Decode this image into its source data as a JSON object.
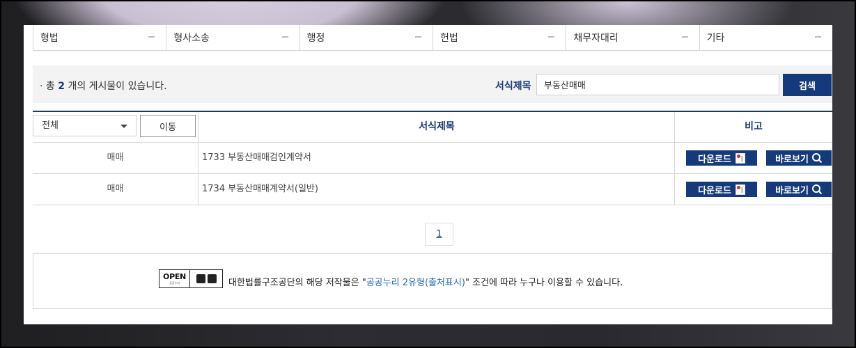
{
  "categories": [
    "형법",
    "형사소송",
    "행정",
    "헌법",
    "채무자대리",
    "기타"
  ],
  "search": {
    "total_prefix": "· 총",
    "total_count": "2",
    "total_suffix": "개의 게시물이 있습니다.",
    "label": "서식제목",
    "value": "부동산매매",
    "button": "검색"
  },
  "table": {
    "filter_value": "전체",
    "move_button": "이동",
    "col_title": "서식제목",
    "col_note": "비고",
    "rows": [
      {
        "category": "매매",
        "title": "1733 부동산매매검인계약서",
        "download": "다운로드",
        "view": "바로보기"
      },
      {
        "category": "매매",
        "title": "1734 부동산매매계약서(일반)",
        "download": "다운로드",
        "view": "바로보기"
      }
    ]
  },
  "pagination": {
    "current": "1"
  },
  "license": {
    "badge": "OPEN",
    "badge_sub": "공공누리",
    "text_prefix": "대한법률구조공단의 해당 저작물은 \"",
    "link": "공공누리 2유형(출처표시)",
    "text_suffix": "\" 조건에 따라 누구나 이용할 수 있습니다."
  },
  "colors": {
    "accent": "#153a7c",
    "link": "#2a6ab3"
  }
}
